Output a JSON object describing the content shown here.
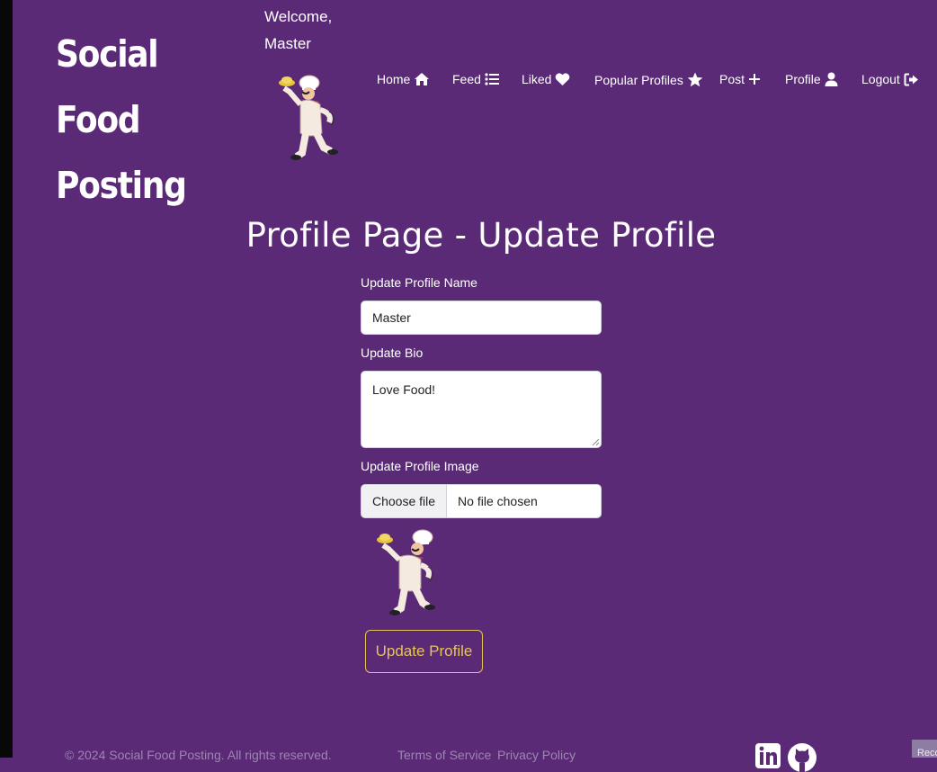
{
  "brand": {
    "title": "Social Food Posting"
  },
  "header": {
    "welcome": "Welcome, Master"
  },
  "nav": {
    "items": [
      {
        "label": "Home",
        "icon": "home-icon"
      },
      {
        "label": "Feed",
        "icon": "list-icon"
      },
      {
        "label": "Liked",
        "icon": "heart-icon"
      },
      {
        "label": "Popular Profiles",
        "icon": "star-icon"
      },
      {
        "label": "Post",
        "icon": "plus-icon"
      },
      {
        "label": "Profile",
        "icon": "user-icon"
      },
      {
        "label": "Logout",
        "icon": "logout-icon"
      }
    ]
  },
  "page": {
    "title": "Profile Page - Update Profile"
  },
  "form": {
    "name_label": "Update Profile Name",
    "name_value": "Master",
    "bio_label": "Update Bio",
    "bio_value": "Love Food!",
    "image_label": "Update Profile Image",
    "file_button": "Choose file",
    "file_status": "No file chosen",
    "submit_label": "Update Profile"
  },
  "footer": {
    "copyright": "© 2024 Social Food Posting. All rights reserved.",
    "terms": "Terms of Service",
    "privacy": "Privacy Policy",
    "social_icons": [
      "linkedin-icon",
      "github-icon"
    ]
  },
  "corner_badge": "Reco",
  "colors": {
    "background": "#5a2a76",
    "accent": "#e7c25a",
    "text": "#ffffff"
  }
}
